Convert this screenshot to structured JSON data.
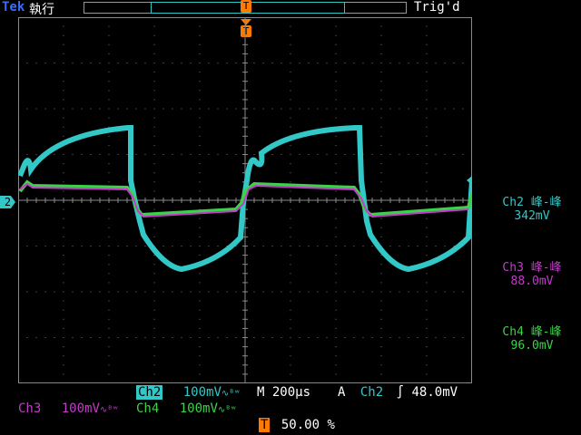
{
  "header": {
    "brand": "Tek",
    "status": "執行",
    "trigger_state": "Trig'd",
    "trigger_marker": "T"
  },
  "markers": {
    "ch2_ground": "2",
    "trigger_pos": "T"
  },
  "measurements": [
    {
      "title": "Ch2 峰-峰",
      "value": "342mV",
      "color": "#32c8c8"
    },
    {
      "title": "Ch3 峰-峰",
      "value": "88.0mV",
      "color": "#c23cc8"
    },
    {
      "title": "Ch4 峰-峰",
      "value": "96.0mV",
      "color": "#3cd24a"
    }
  ],
  "footer": {
    "ch2_label": "Ch2",
    "ch2_scale": "100mV",
    "ch3_label": "Ch3",
    "ch3_scale": "100mV",
    "ch4_label": "Ch4",
    "ch4_scale": "100mV",
    "bw_symbol": "∿ᴮʷ",
    "timebase_label": "M",
    "timebase_value": "200μs",
    "trigger_mode": "A",
    "trigger_source": "Ch2",
    "trigger_slope": "∫",
    "trigger_level": "48.0mV",
    "position_marker": "T",
    "position_value": "50.00 %"
  },
  "colors": {
    "ch2": "#32c8c8",
    "ch3": "#c23cc8",
    "ch4": "#3cd24a",
    "grid": "#6e6e6e",
    "accent": "#ff7a00"
  }
}
